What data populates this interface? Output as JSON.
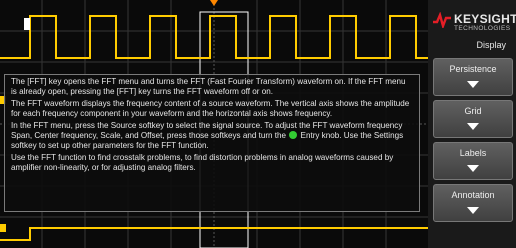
{
  "brand": {
    "name": "KEYSIGHT",
    "sub": "TECHNOLOGIES"
  },
  "menu": {
    "title": "Display",
    "softkeys": [
      {
        "label": "Persistence"
      },
      {
        "label": "Grid"
      },
      {
        "label": "Labels"
      },
      {
        "label": "Annotation"
      }
    ]
  },
  "help": {
    "p1": "The [FFT] key opens the FFT menu and turns the FFT (Fast Fourier Transform) waveform on. If the FFT menu is already open, pressing the [FFT] key turns the FFT waveform off or on.",
    "p2": "The FFT waveform displays the frequency content of a source waveform. The vertical axis shows the amplitude for each frequency component in your waveform and the horizontal axis shows frequency.",
    "p3_a": "In the FFT menu, press the Source softkey to select the signal source. To adjust the FFT waveform frequency Span, Center frequency, Scale, and Offset, press those softkeys and turn the",
    "p3_b": "Entry knob. Use the Settings softkey to set up other parameters for the FFT function.",
    "p4": "Use the FFT function to find crosstalk problems, to find distortion problems in analog waveforms caused by amplifier non-linearity, or for adjusting analog filters."
  },
  "colors": {
    "trace": "#ffcc00",
    "trigger": "#ff8800",
    "grid": "#3a3a3a",
    "entry": "#33cc33"
  }
}
